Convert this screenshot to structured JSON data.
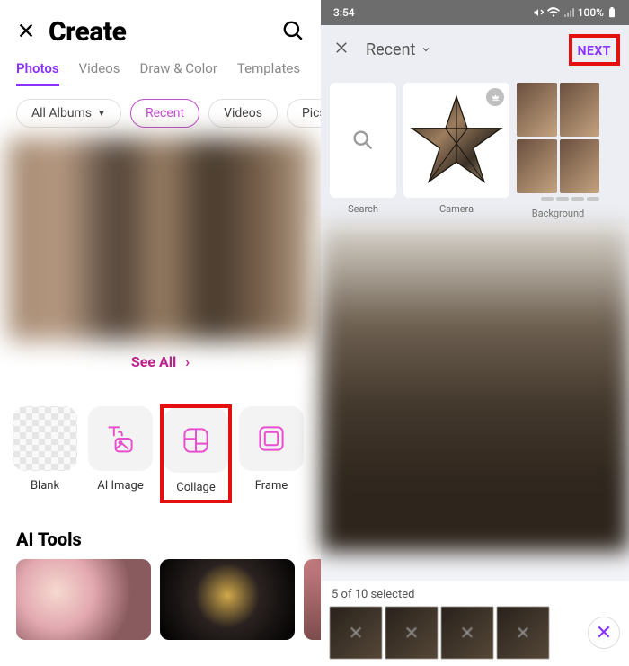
{
  "left": {
    "title": "Create",
    "tabs": [
      "Photos",
      "Videos",
      "Draw & Color",
      "Templates"
    ],
    "active_tab": 0,
    "filters": {
      "all_albums": "All Albums",
      "recent": "Recent",
      "videos": "Videos",
      "picsart": "Picsart"
    },
    "see_all": "See All",
    "tools": {
      "blank": "Blank",
      "ai_image": "AI Image",
      "collage": "Collage",
      "frame": "Frame"
    },
    "ai_tools_title": "AI Tools"
  },
  "right": {
    "status": {
      "time": "3:54",
      "battery": "100%"
    },
    "header": {
      "title": "Recent",
      "next": "NEXT"
    },
    "templates": {
      "search": "Search",
      "camera": "Camera",
      "background": "Background"
    },
    "selection": {
      "text": "5 of 10 selected",
      "count": 5,
      "total": 10
    }
  },
  "colors": {
    "accent_purple": "#8a32ff",
    "accent_magenta": "#c24ccf",
    "highlight_red": "#e41010"
  }
}
